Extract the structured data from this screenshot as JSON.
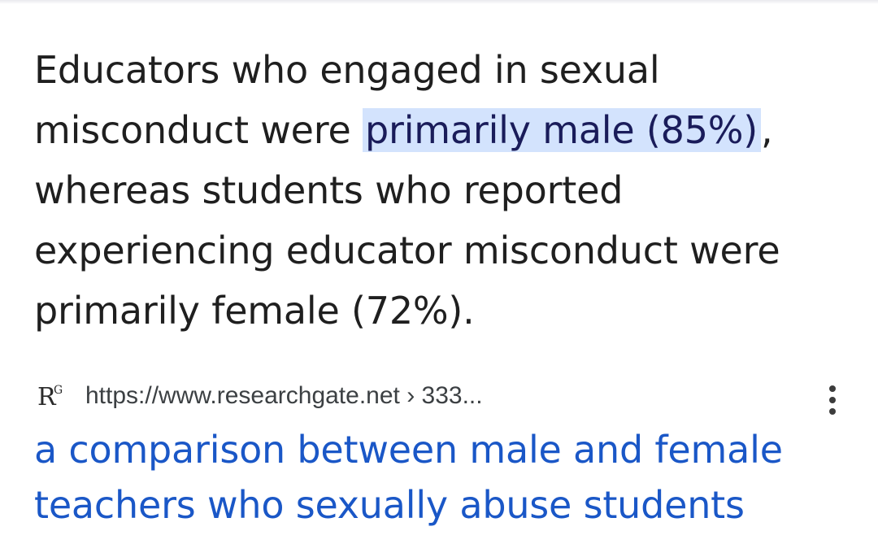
{
  "snippet": {
    "before": "Educators who engaged in sexual misconduct were ",
    "highlight": "primarily male (85%)",
    "after": ", whereas students who reported experiencing educator misconduct were primarily female (72%)."
  },
  "source": {
    "favicon_text": "R",
    "favicon_superscript": "G",
    "url": "https://www.researchgate.net › 333..."
  },
  "result": {
    "title": "a comparison between male and female teachers who sexually abuse students"
  },
  "icons": {
    "more": "more-vert-icon"
  },
  "colors": {
    "highlight_bg": "#d3e3fd",
    "link": "#1a57c7",
    "text": "#1f1f1f"
  }
}
